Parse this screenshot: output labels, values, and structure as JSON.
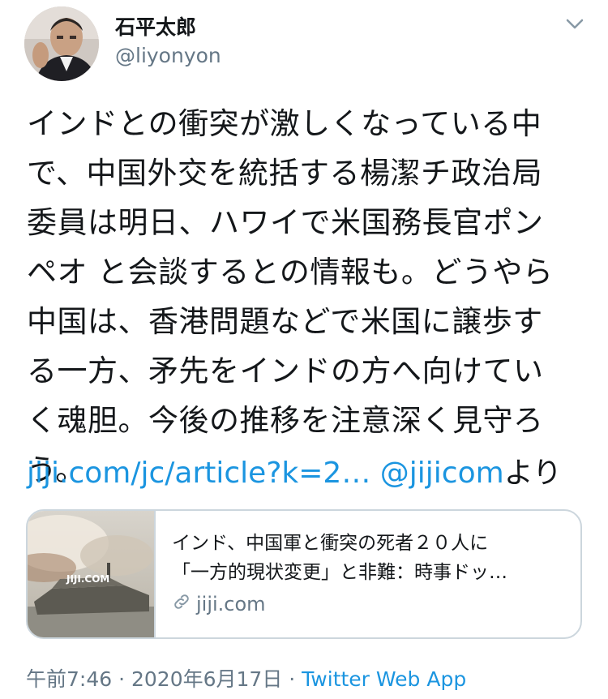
{
  "author": {
    "name": "石平太郎",
    "handle": "@liyonyon"
  },
  "icons": {
    "avatar": "user-avatar-photo",
    "menu": "chevron-down-icon",
    "link": "link-icon"
  },
  "tweet": {
    "lines": [
      "インドとの衝突が激しくなっている中",
      "で、中国外交を統括する楊潔チ政治局",
      "委員は明日、ハワイで米国務長官ポン",
      "ペオ と会談するとの情報も。どうやら",
      "中国は、香港問題などで米国に譲歩す",
      "る一方、矛先をインドの方へ向けてい",
      "く魂胆。今後の推移を注意深く見守ろ",
      "う。"
    ],
    "url_text": "jiji.com/jc/article?k=2…",
    "mention": "@jijicom",
    "suffix": "より"
  },
  "card": {
    "title_line1": "インド、中国軍と衝突の死者２０人に",
    "title_line2": "「一方的現状変更」と非難：時事ドッ…",
    "domain": "jiji.com",
    "thumb_watermark": "JIJI.COM"
  },
  "meta": {
    "time": "午前7:46",
    "separator": " · ",
    "date": "2020年6月17日",
    "source": "Twitter Web App"
  },
  "colors": {
    "link": "#1b95e0",
    "secondary_text": "#657786",
    "border": "#ccd6dd"
  }
}
